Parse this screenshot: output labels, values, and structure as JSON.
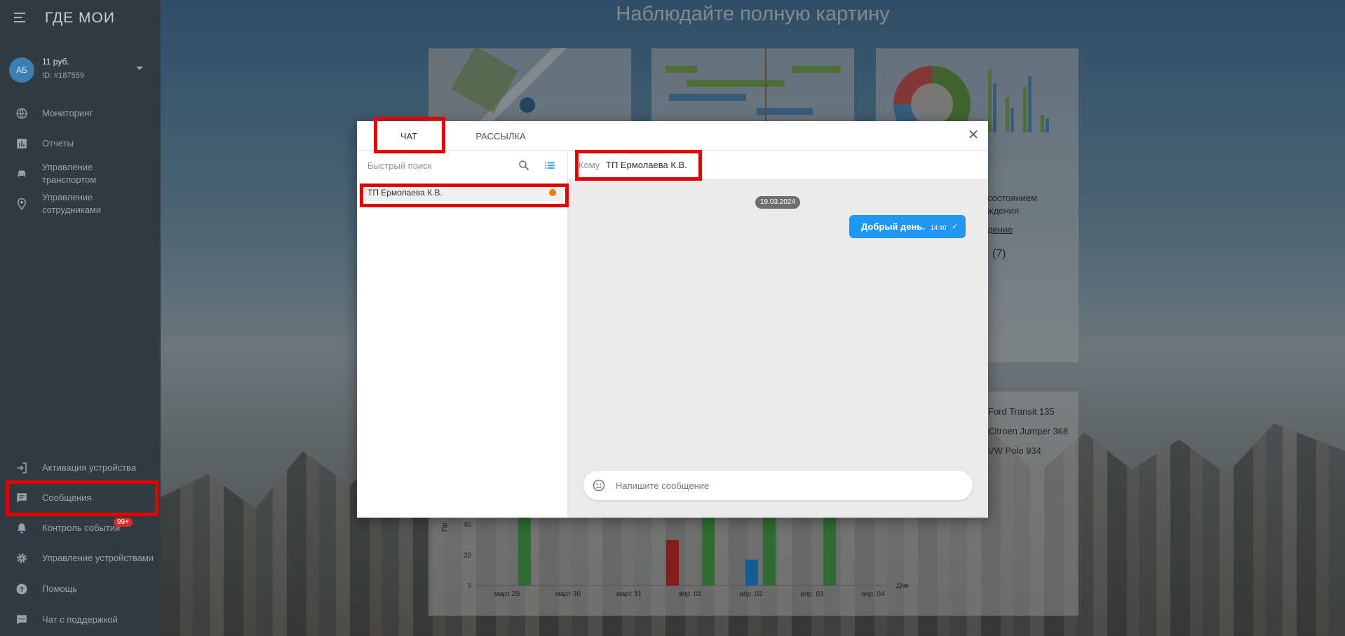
{
  "background": {
    "heading": "Наблюдайте полную картину",
    "card_text_1": "состоянием",
    "card_text_2": "ждения",
    "card_link": "дение",
    "card_count": "(7)",
    "vehicles": [
      "Ford Transit 135",
      "Citroen Jumper 368",
      "VW Polo 934"
    ],
    "chart": {
      "ylabel": "Пр",
      "yticks": [
        "40",
        "20",
        "0"
      ],
      "xticks": [
        "март 29",
        "март 30",
        "март 31",
        "апр. 01",
        "апр. 02",
        "апр. 03",
        "апр. 04"
      ],
      "xlabel": "Дни"
    }
  },
  "sidebar": {
    "logo": "ГДЕ МОИ",
    "account": {
      "initials": "АБ",
      "balance": "11 руб.",
      "id": "ID: #187559"
    },
    "nav_top": [
      {
        "label": "Мониторинг",
        "icon": "globe-icon"
      },
      {
        "label": "Отчеты",
        "icon": "bar-chart-icon"
      },
      {
        "label": "Управление транспортом",
        "icon": "car-icon"
      },
      {
        "label": "Управление сотрудниками",
        "icon": "location-pin-icon"
      }
    ],
    "nav_bottom": [
      {
        "label": "Активация устройства",
        "icon": "login-icon"
      },
      {
        "label": "Сообщения",
        "icon": "message-icon"
      },
      {
        "label": "Контроль событий",
        "icon": "bell-icon"
      },
      {
        "label": "Управление устройствами",
        "icon": "gear-icon"
      },
      {
        "label": "Помощь",
        "icon": "help-icon"
      },
      {
        "label": "Чат с поддержкой",
        "icon": "chat-icon"
      }
    ],
    "events_badge": "99+"
  },
  "modal": {
    "tabs": [
      {
        "label": "ЧАТ",
        "active": true
      },
      {
        "label": "РАССЫЛКА",
        "active": false
      }
    ],
    "search_placeholder": "Быстрый поиск",
    "contacts": [
      {
        "name": "ТП Ермолаева К.В.",
        "unread": true
      }
    ],
    "to_label": "Кому",
    "to_name": "ТП Ермолаева К.В.",
    "messages": [
      {
        "date": "19.03.2024",
        "text": "Добрый день.",
        "time": "14:40",
        "outgoing": true
      }
    ],
    "compose_placeholder": "Напишите сообщение"
  },
  "colors": {
    "accent": "#2196f3",
    "sidebar_bg": "#333b42",
    "highlight": "#e50000",
    "unread_dot": "#f57c00"
  }
}
